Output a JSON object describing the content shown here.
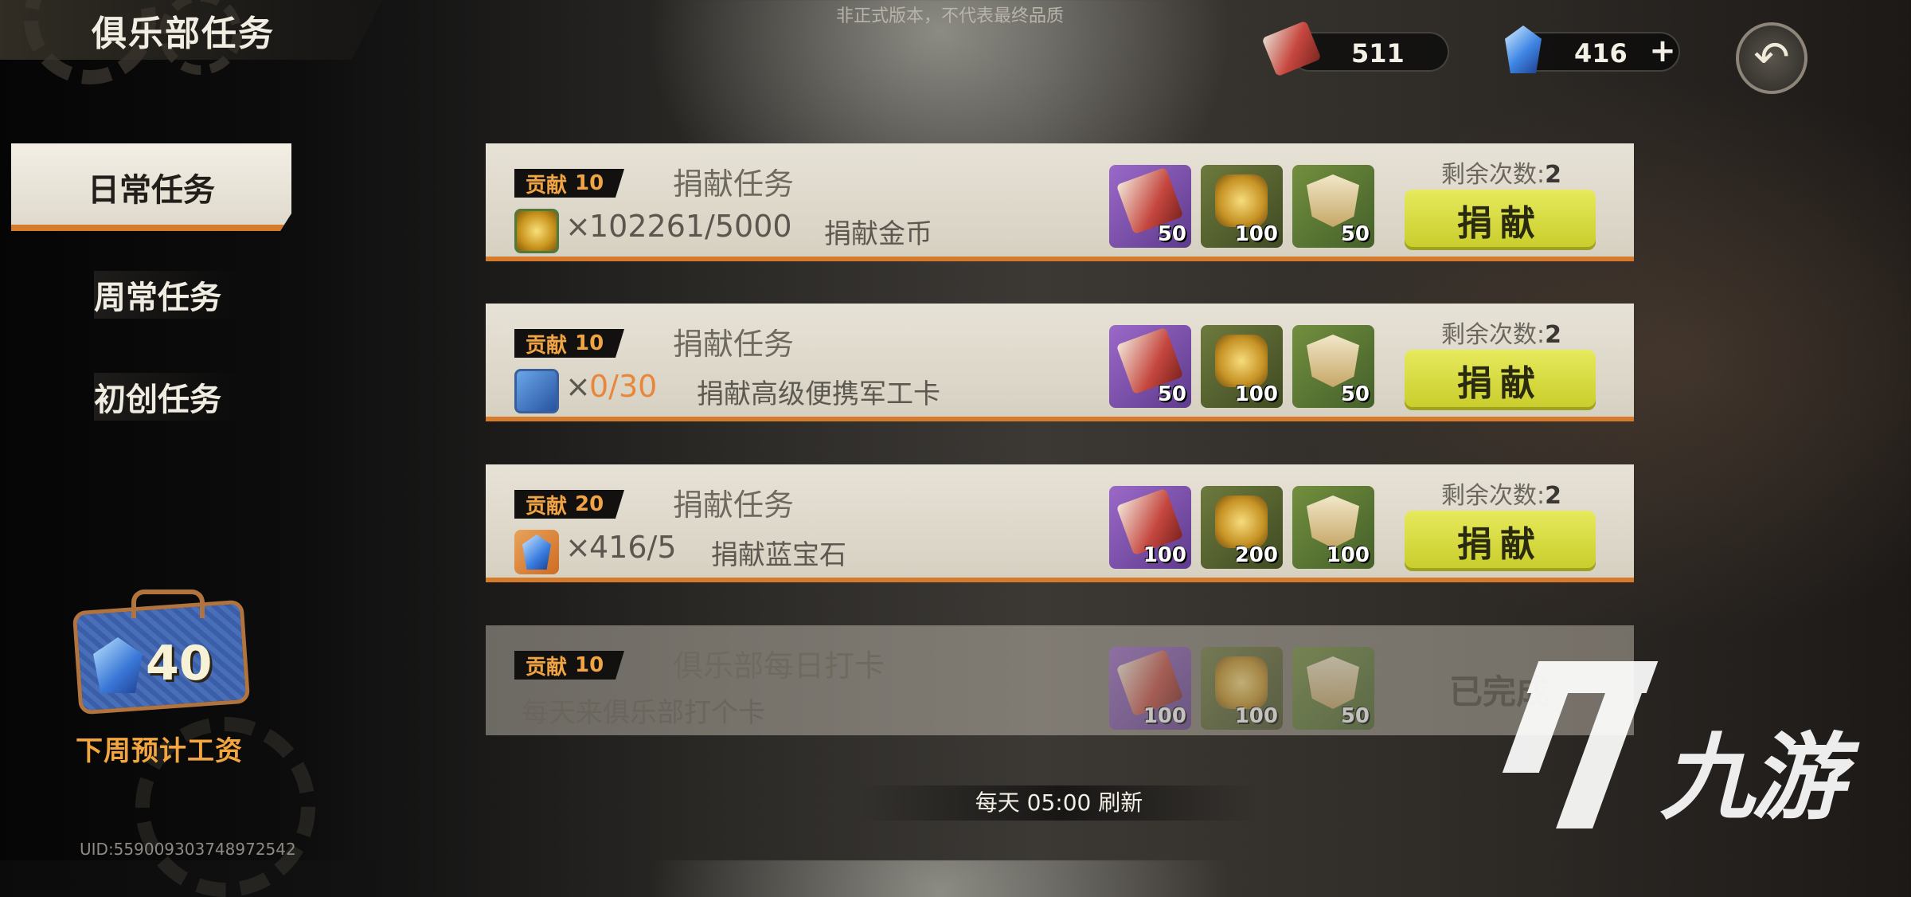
{
  "header": {
    "title": "俱乐部任务",
    "watermark_top": "非正式版本，不代表最终品质"
  },
  "currency": {
    "tickets": "511",
    "gems": "416",
    "plus_label": "+",
    "back_glyph": "↶"
  },
  "sidebar": {
    "tabs": [
      {
        "label": "日常任务",
        "active": true
      },
      {
        "label": "周常任务",
        "active": false
      },
      {
        "label": "初创任务",
        "active": false
      }
    ]
  },
  "salary": {
    "value": "40",
    "label": "下周预计工资"
  },
  "uid": "UID:559009303748972542",
  "badge_label": "贡献",
  "tasks": [
    {
      "contribution": "10",
      "title": "捐献任务",
      "x": "×",
      "count": "102261/5000",
      "desc": "捐献金币",
      "rewards": [
        "50",
        "100",
        "50"
      ],
      "remaining_label": "剩余次数:",
      "remaining": "2",
      "button": "捐献"
    },
    {
      "contribution": "10",
      "title": "捐献任务",
      "x": "×",
      "count": "0/30",
      "desc": "捐献高级便携军工卡",
      "rewards": [
        "50",
        "100",
        "50"
      ],
      "remaining_label": "剩余次数:",
      "remaining": "2",
      "button": "捐献"
    },
    {
      "contribution": "20",
      "title": "捐献任务",
      "x": "×",
      "count": "416/5",
      "desc": "捐献蓝宝石",
      "rewards": [
        "100",
        "200",
        "100"
      ],
      "remaining_label": "剩余次数:",
      "remaining": "2",
      "button": "捐献"
    },
    {
      "contribution": "10",
      "title": "俱乐部每日打卡",
      "desc": "每天来俱乐部打个卡",
      "rewards": [
        "100",
        "100",
        "50"
      ],
      "status": "已完成"
    }
  ],
  "footer": {
    "refresh": "每天 05:00 刷新"
  },
  "logo_text": "九游",
  "colors": {
    "accent_orange": "#d67a2c",
    "button_yellow": "#d8dc40",
    "warn_count": "#e8873a",
    "salary_label": "#f3a640"
  },
  "icons": [
    "ticket-icon",
    "gem-icon",
    "back-arrow-icon",
    "gold-coin-icon",
    "military-card-icon",
    "sapphire-icon",
    "fist-token-icon",
    "shield-emblem-icon",
    "briefcase-icon"
  ]
}
